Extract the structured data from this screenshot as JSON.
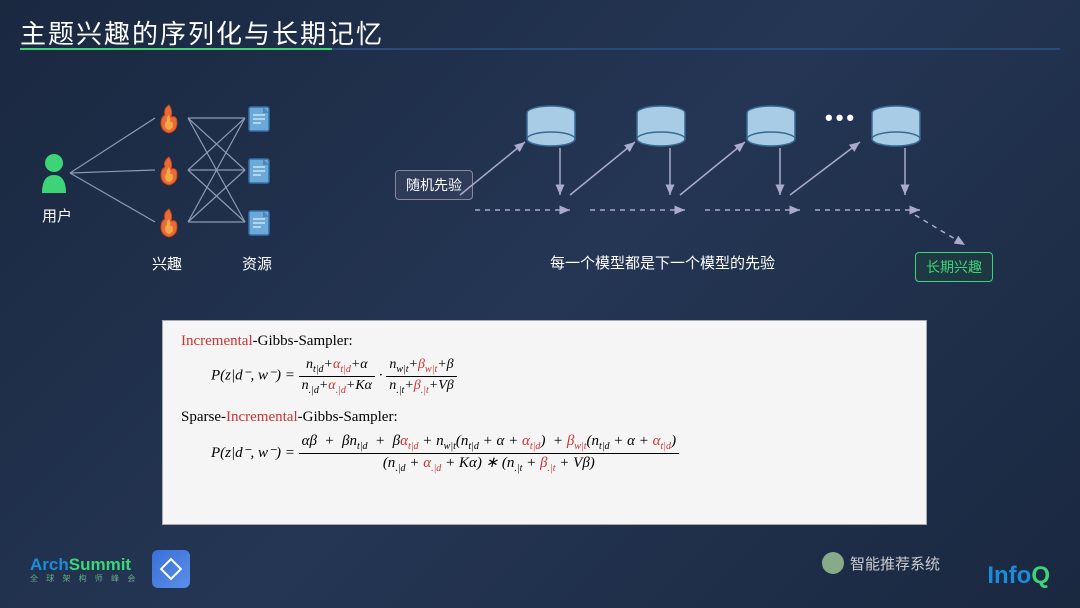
{
  "title": "主题兴趣的序列化与长期记忆",
  "userLabel": "用户",
  "interestLabel": "兴趣",
  "resourceLabel": "资源",
  "priorLabel": "随机先验",
  "modelDesc": "每一个模型都是下一个模型的先验",
  "longtermLabel": "长期兴趣",
  "ellipsis": "•••",
  "formula": {
    "title1_a": "Incremental",
    "title1_b": "-Gibbs-Sampler:",
    "lhs": "P(z|d⁻, w⁻) =",
    "title2_a": "Sparse-",
    "title2_b": "Incremental",
    "title2_c": "-Gibbs-Sampler:"
  },
  "footer": {
    "archA": "Arch",
    "archS": "Summit",
    "archSub": "全 球 架 构 师 峰 会",
    "wechat": "智能推荐系统",
    "infoI": "Info",
    "infoQ": "Q"
  }
}
